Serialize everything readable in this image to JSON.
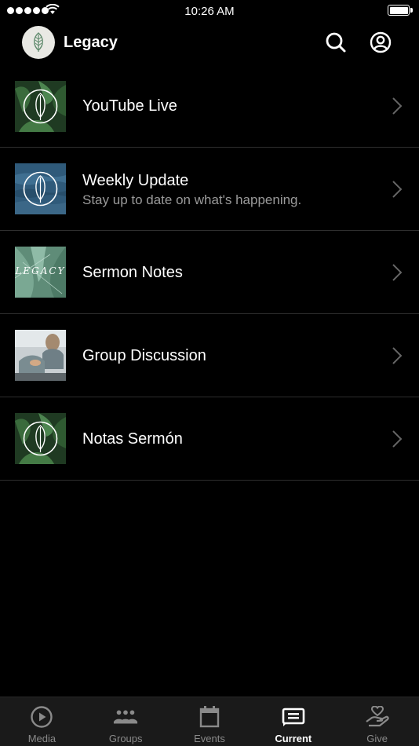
{
  "status_bar": {
    "time": "10:26 AM"
  },
  "header": {
    "title": "Legacy"
  },
  "list": [
    {
      "title": "YouTube Live",
      "subtitle": ""
    },
    {
      "title": "Weekly Update",
      "subtitle": "Stay up to date on what's happening."
    },
    {
      "title": "Sermon Notes",
      "subtitle": "",
      "thumb_text": "LEGACY"
    },
    {
      "title": "Group Discussion",
      "subtitle": ""
    },
    {
      "title": "Notas Sermón",
      "subtitle": ""
    }
  ],
  "tabs": [
    {
      "label": "Media",
      "icon": "play-circle-icon"
    },
    {
      "label": "Groups",
      "icon": "groups-icon"
    },
    {
      "label": "Events",
      "icon": "calendar-icon"
    },
    {
      "label": "Current",
      "icon": "current-icon",
      "active": true
    },
    {
      "label": "Give",
      "icon": "give-icon"
    }
  ],
  "colors": {
    "background": "#000000",
    "tab_bar": "#1a1a1a",
    "subtitle": "#9a9a9a",
    "inactive_tab": "#8a8a8a"
  }
}
